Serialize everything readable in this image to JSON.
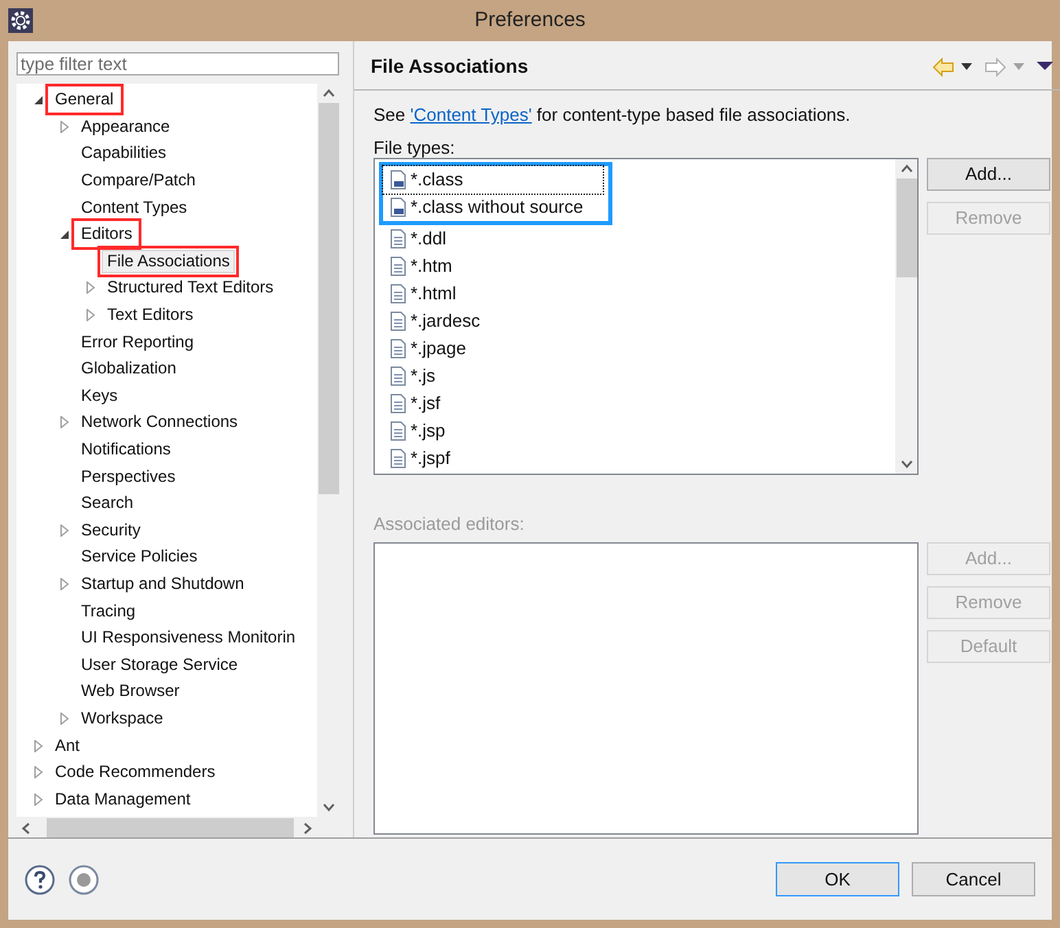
{
  "window": {
    "title": "Preferences"
  },
  "filter": {
    "placeholder": "type filter text"
  },
  "tree": [
    {
      "label": "General",
      "expanded": true,
      "selected": false,
      "marked": true,
      "children": [
        {
          "label": "Appearance",
          "expanded": false,
          "selected": false,
          "marked": false
        },
        {
          "label": "Capabilities",
          "selected": false,
          "marked": false
        },
        {
          "label": "Compare/Patch",
          "selected": false,
          "marked": false
        },
        {
          "label": "Content Types",
          "selected": false,
          "marked": false
        },
        {
          "label": "Editors",
          "expanded": true,
          "selected": false,
          "marked": true,
          "children": [
            {
              "label": "File Associations",
              "selected": true,
              "marked": true
            },
            {
              "label": "Structured Text Editors",
              "expanded": false,
              "selected": false,
              "marked": false
            },
            {
              "label": "Text Editors",
              "expanded": false,
              "selected": false,
              "marked": false
            }
          ]
        },
        {
          "label": "Error Reporting",
          "selected": false,
          "marked": false
        },
        {
          "label": "Globalization",
          "selected": false,
          "marked": false
        },
        {
          "label": "Keys",
          "selected": false,
          "marked": false
        },
        {
          "label": "Network Connections",
          "expanded": false,
          "selected": false,
          "marked": false
        },
        {
          "label": "Notifications",
          "selected": false,
          "marked": false
        },
        {
          "label": "Perspectives",
          "selected": false,
          "marked": false
        },
        {
          "label": "Search",
          "selected": false,
          "marked": false
        },
        {
          "label": "Security",
          "expanded": false,
          "selected": false,
          "marked": false
        },
        {
          "label": "Service Policies",
          "selected": false,
          "marked": false
        },
        {
          "label": "Startup and Shutdown",
          "expanded": false,
          "selected": false,
          "marked": false
        },
        {
          "label": "Tracing",
          "selected": false,
          "marked": false
        },
        {
          "label": "UI Responsiveness Monitorin",
          "selected": false,
          "marked": false
        },
        {
          "label": "User Storage Service",
          "selected": false,
          "marked": false
        },
        {
          "label": "Web Browser",
          "selected": false,
          "marked": false
        },
        {
          "label": "Workspace",
          "expanded": false,
          "selected": false,
          "marked": false
        }
      ]
    },
    {
      "label": "Ant",
      "expanded": false,
      "selected": false,
      "marked": false
    },
    {
      "label": "Code Recommenders",
      "expanded": false,
      "selected": false,
      "marked": false
    },
    {
      "label": "Data Management",
      "expanded": false,
      "selected": false,
      "marked": false
    }
  ],
  "page": {
    "title": "File Associations",
    "intro": {
      "before": "See ",
      "link": "'Content Types'",
      "after": " for content-type based file associations."
    },
    "file_types_label": "File types:",
    "file_types": [
      {
        "label": "*.class",
        "selected": true,
        "marked": true
      },
      {
        "label": "*.class without source",
        "selected": false,
        "marked": true
      },
      {
        "label": "*.ddl",
        "selected": false,
        "marked": false
      },
      {
        "label": "*.htm",
        "selected": false,
        "marked": false
      },
      {
        "label": "*.html",
        "selected": false,
        "marked": false
      },
      {
        "label": "*.jardesc",
        "selected": false,
        "marked": false
      },
      {
        "label": "*.jpage",
        "selected": false,
        "marked": false
      },
      {
        "label": "*.js",
        "selected": false,
        "marked": false
      },
      {
        "label": "*.jsf",
        "selected": false,
        "marked": false
      },
      {
        "label": "*.jsp",
        "selected": false,
        "marked": false
      },
      {
        "label": "*.jspf",
        "selected": false,
        "marked": false
      }
    ],
    "file_type_buttons": [
      {
        "label": "Add...",
        "disabled": false
      },
      {
        "label": "Remove",
        "disabled": true
      }
    ],
    "editors_label": "Associated editors:",
    "editors_label_disabled": true,
    "editor_buttons": [
      {
        "label": "Add...",
        "disabled": true
      },
      {
        "label": "Remove",
        "disabled": true
      },
      {
        "label": "Default",
        "disabled": true
      }
    ]
  },
  "footer": {
    "buttons": [
      {
        "label": "OK",
        "default": true
      },
      {
        "label": "Cancel",
        "default": false
      }
    ]
  }
}
